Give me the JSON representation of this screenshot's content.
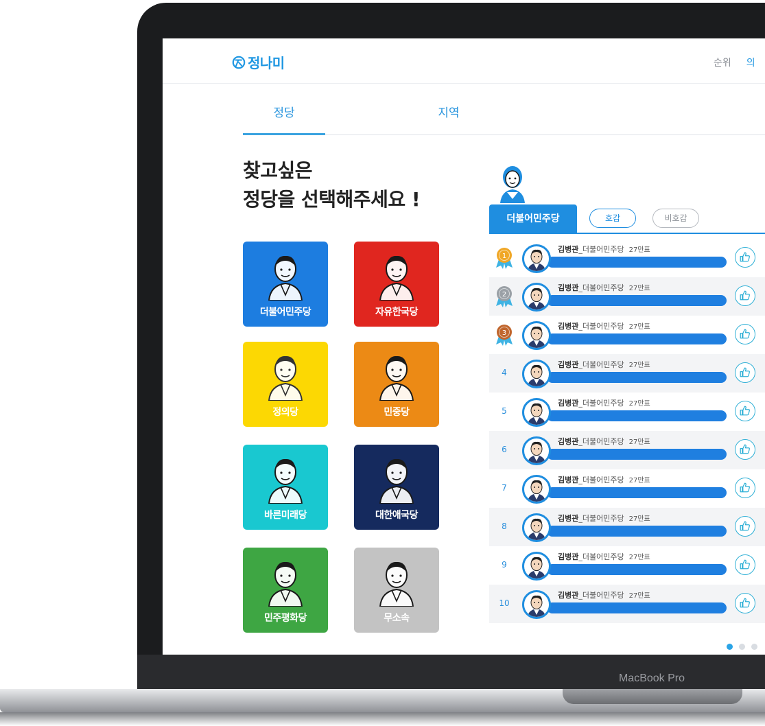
{
  "app": {
    "logo_text": "정나미",
    "logo_icon": "smile-face-icon"
  },
  "header_nav": {
    "rank": "순위",
    "more": "의"
  },
  "tabs": [
    {
      "label": "정당"
    },
    {
      "label": "지역"
    }
  ],
  "heading": {
    "line1": "찾고싶은",
    "line2": "정당을 선택해주세요 !"
  },
  "parties": [
    {
      "label": "더불어민주당",
      "color": "#1d7de0"
    },
    {
      "label": "자유한국당",
      "color": "#e0261f"
    },
    {
      "label": "정의당",
      "color": "#fcd803"
    },
    {
      "label": "민중당",
      "color": "#ec8a15"
    },
    {
      "label": "바른미래당",
      "color": "#19c8d0"
    },
    {
      "label": "대한애국당",
      "color": "#152a5e"
    },
    {
      "label": "민주평화당",
      "color": "#3ea643"
    },
    {
      "label": "무소속",
      "color": "#c3c3c3"
    }
  ],
  "ranking": {
    "selected_party": "더불어민주당",
    "filters": {
      "like": "호감",
      "dislike": "비호감"
    },
    "rows": [
      {
        "rank": "1",
        "name": "김병관",
        "party": "_더불어민주당",
        "votes": "27만표"
      },
      {
        "rank": "2",
        "name": "김병관",
        "party": "_더불어민주당",
        "votes": "27만표"
      },
      {
        "rank": "3",
        "name": "김병관",
        "party": "_더불어민주당",
        "votes": "27만표"
      },
      {
        "rank": "4",
        "name": "김병관",
        "party": "_더불어민주당",
        "votes": "27만표"
      },
      {
        "rank": "5",
        "name": "김병관",
        "party": "_더불어민주당",
        "votes": "27만표"
      },
      {
        "rank": "6",
        "name": "김병관",
        "party": "_더불어민주당",
        "votes": "27만표"
      },
      {
        "rank": "7",
        "name": "김병관",
        "party": "_더불어민주당",
        "votes": "27만표"
      },
      {
        "rank": "8",
        "name": "김병관",
        "party": "_더불어민주당",
        "votes": "27만표"
      },
      {
        "rank": "9",
        "name": "김병관",
        "party": "_더불어민주당",
        "votes": "27만표"
      },
      {
        "rank": "10",
        "name": "김병관",
        "party": "_더불어민주당",
        "votes": "27만표"
      }
    ],
    "medal_colors": [
      "#f0a727",
      "#9aa0a6",
      "#c0652c"
    ],
    "pager": {
      "pages": 3,
      "current": 1
    }
  },
  "device_label": "MacBook Pro"
}
